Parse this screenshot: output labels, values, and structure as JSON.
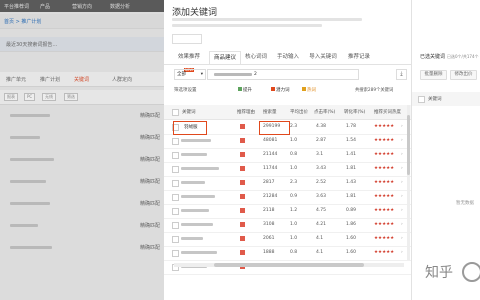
{
  "bg": {
    "topbar": [
      "平台推荐词",
      "产品",
      "营销方向",
      "数据分析"
    ],
    "breadcrumb": "首页 > 推广计划",
    "notice": "最近30天搜索词报告…",
    "tabs": [
      "推广单元",
      "推广计划",
      "关键词",
      "人群定向"
    ],
    "pills": [
      "报表",
      "PC",
      "无线",
      "筛选"
    ],
    "col_labels": [
      "精确匹配",
      "精确匹配",
      "精确匹配",
      "精确匹配",
      "精确匹配",
      "精确匹配",
      "精确匹配"
    ]
  },
  "modal": {
    "title": "添加关键词",
    "tabs": [
      "效果推荐",
      "商品建议",
      "核心词词",
      "手动输入",
      "导入关键词",
      "推荐记录"
    ],
    "new_badge": "NEW",
    "scope_select": "全部",
    "keyword_input": "2",
    "filter_label": "筛选项设置",
    "toggles": [
      "提升",
      "潜力词",
      "热词"
    ],
    "result_text": "共搜索289个关键词",
    "headers": [
      "关键词",
      "推荐理由",
      "搜索量",
      "平均出价",
      "点击率(%)",
      "转化率(%)",
      "推荐买词热度"
    ],
    "rows": [
      {
        "kw": "羽绒服",
        "search": "299199",
        "bid": "2.3",
        "ctr": "4.38",
        "cvr": "1.78",
        "stars": "★★★★★"
      },
      {
        "kw": "",
        "search": "48081",
        "bid": "1.0",
        "ctr": "2.87",
        "cvr": "1.54",
        "stars": "★★★★★"
      },
      {
        "kw": "",
        "search": "21144",
        "bid": "0.8",
        "ctr": "3.1",
        "cvr": "1.41",
        "stars": "★★★★★"
      },
      {
        "kw": "",
        "search": "11744",
        "bid": "1.0",
        "ctr": "3.43",
        "cvr": "1.81",
        "stars": "★★★★★"
      },
      {
        "kw": "",
        "search": "2817",
        "bid": "2.3",
        "ctr": "2.52",
        "cvr": "1.43",
        "stars": "★★★★★"
      },
      {
        "kw": "",
        "search": "21284",
        "bid": "0.9",
        "ctr": "3.63",
        "cvr": "1.81",
        "stars": "★★★★★"
      },
      {
        "kw": "",
        "search": "2118",
        "bid": "1.2",
        "ctr": "4.75",
        "cvr": "0.89",
        "stars": "★★★★★"
      },
      {
        "kw": "",
        "search": "3108",
        "bid": "1.0",
        "ctr": "4.21",
        "cvr": "1.86",
        "stars": "★★★★★"
      },
      {
        "kw": "",
        "search": "2061",
        "bid": "1.0",
        "ctr": "4.1",
        "cvr": "1.60",
        "stars": "★★★★★"
      },
      {
        "kw": "",
        "search": "1888",
        "bid": "0.8",
        "ctr": "4.1",
        "cvr": "1.60",
        "stars": "★★★★★"
      },
      {
        "kw": "",
        "search": "1568",
        "bid": "0.8",
        "ctr": "3.19",
        "cvr": "1.64",
        "stars": "★★★★★"
      }
    ]
  },
  "right": {
    "title": "已选关键词",
    "count_text": "已选0个/共174个",
    "buttons": [
      "批量删除",
      "修改出价"
    ],
    "col": "关键词",
    "empty": "暂无数据"
  },
  "watermark": "知乎"
}
